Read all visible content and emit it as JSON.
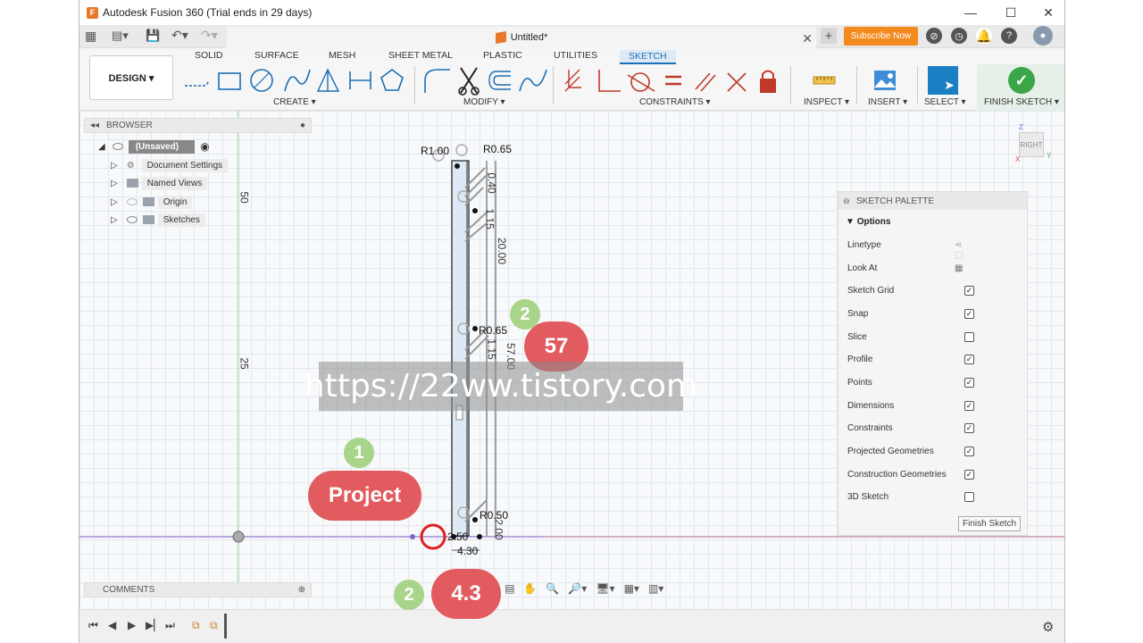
{
  "window": {
    "title": "Autodesk Fusion 360 (Trial ends in 29 days)",
    "app_icon": "F"
  },
  "tabbar": {
    "doc_title": "Untitled*",
    "subscribe_label": "Subscribe Now"
  },
  "toolbar": {
    "design_label": "DESIGN ▾",
    "workspace_tabs": [
      "SOLID",
      "SURFACE",
      "MESH",
      "SHEET METAL",
      "PLASTIC",
      "UTILITIES",
      "SKETCH"
    ],
    "active_tab": "SKETCH",
    "groups": {
      "create": "CREATE ▾",
      "modify": "MODIFY ▾",
      "constraints": "CONSTRAINTS ▾",
      "inspect": "INSPECT ▾",
      "insert": "INSERT ▾",
      "select": "SELECT ▾",
      "finish": "FINISH SKETCH ▾"
    },
    "accent_color": "#1b6fb5"
  },
  "browser": {
    "title": "BROWSER",
    "root_label": "(Unsaved)",
    "items": [
      "Document Settings",
      "Named Views",
      "Origin",
      "Sketches"
    ]
  },
  "comments": {
    "title": "COMMENTS"
  },
  "palette": {
    "title": "SKETCH PALETTE",
    "section": "Options",
    "rows": [
      {
        "label": "Linetype",
        "type": "icon"
      },
      {
        "label": "Look At",
        "type": "icon"
      },
      {
        "label": "Sketch Grid",
        "checked": true
      },
      {
        "label": "Snap",
        "checked": true
      },
      {
        "label": "Slice",
        "checked": false
      },
      {
        "label": "Profile",
        "checked": true
      },
      {
        "label": "Points",
        "checked": true
      },
      {
        "label": "Dimensions",
        "checked": true
      },
      {
        "label": "Constraints",
        "checked": true
      },
      {
        "label": "Projected Geometries",
        "checked": true
      },
      {
        "label": "Construction Geometries",
        "checked": true
      },
      {
        "label": "3D Sketch",
        "checked": false
      }
    ],
    "finish_label": "Finish Sketch"
  },
  "viewcube": {
    "label": "RIGHT",
    "z": "Z",
    "y": "Y",
    "x": "X"
  },
  "canvas": {
    "ruler_50": "50",
    "ruler_25": "25",
    "dims": {
      "r100": "R1.00",
      "r065_top": "R0.65",
      "d040": "0.40",
      "d115_top": "1.15",
      "d2000": "20.00",
      "r065_mid": "R0.65",
      "d115_mid": "1.15",
      "d5700": "57.00",
      "r050": "R0.50",
      "d250": "2.50",
      "d430": "4.30",
      "d200": "2.00"
    }
  },
  "annotations": {
    "num1": "1",
    "label_project": "Project",
    "num2_top": "2",
    "label_57": "57",
    "num2_bottom": "2",
    "label_43": "4.3",
    "watermark": "https://22ww.tistory.com"
  }
}
